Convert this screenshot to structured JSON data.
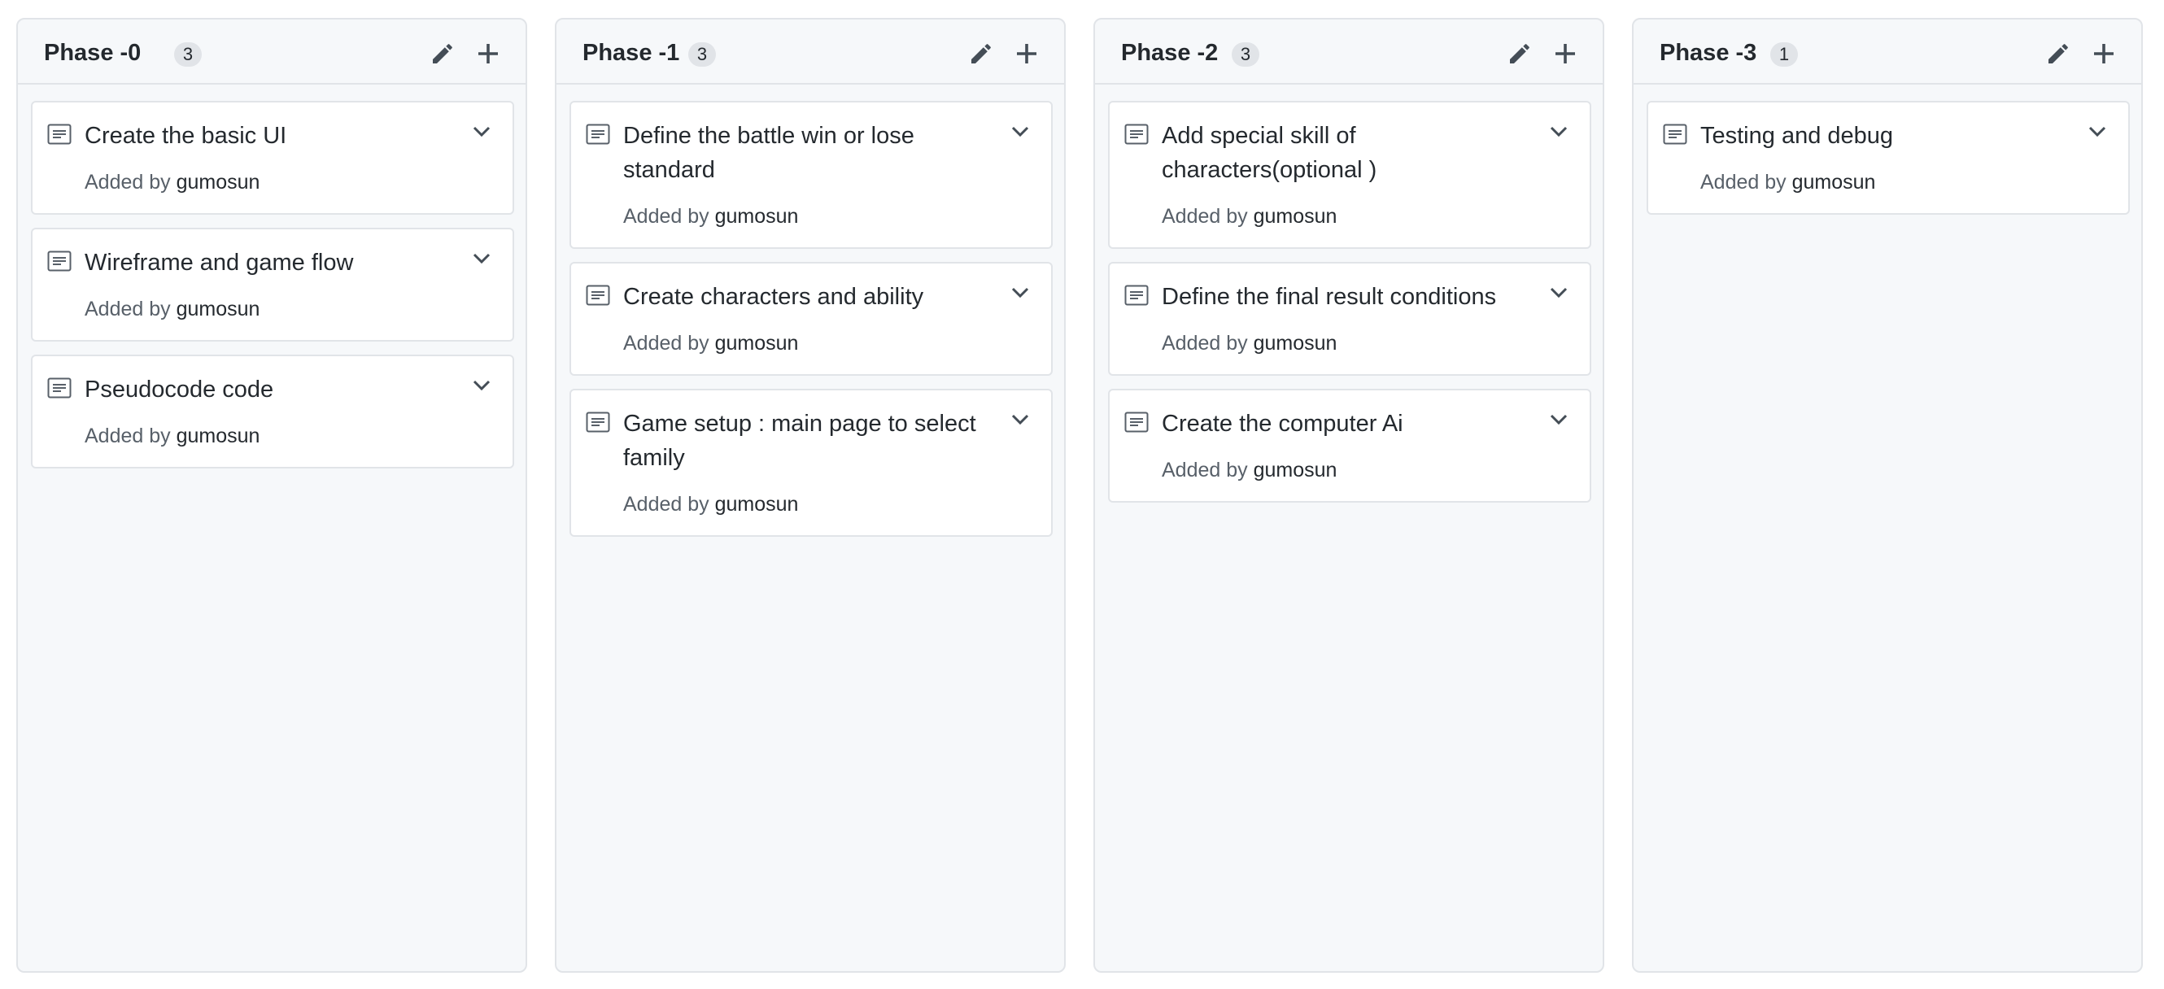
{
  "columns": [
    {
      "name": "Phase -0",
      "count": "3",
      "cards": [
        {
          "title": "Create the basic UI",
          "meta_prefix": "Added by",
          "author": "gumosun"
        },
        {
          "title": "Wireframe and game flow",
          "meta_prefix": "Added by",
          "author": "gumosun"
        },
        {
          "title": "Pseudocode code",
          "meta_prefix": "Added by",
          "author": "gumosun"
        }
      ]
    },
    {
      "name": "Phase -1",
      "count": "3",
      "cards": [
        {
          "title": "Define the battle win or lose standard",
          "meta_prefix": "Added by",
          "author": "gumosun"
        },
        {
          "title": "Create characters and ability",
          "meta_prefix": "Added by",
          "author": "gumosun"
        },
        {
          "title": "Game setup : main page to select family",
          "meta_prefix": "Added by",
          "author": "gumosun"
        }
      ]
    },
    {
      "name": "Phase -2",
      "count": "3",
      "cards": [
        {
          "title": "Add special skill of characters(optional )",
          "meta_prefix": "Added by",
          "author": "gumosun"
        },
        {
          "title": "Define the final result conditions",
          "meta_prefix": "Added by",
          "author": "gumosun"
        },
        {
          "title": "Create the computer Ai",
          "meta_prefix": "Added by",
          "author": "gumosun"
        }
      ]
    },
    {
      "name": "Phase -3",
      "count": "1",
      "cards": [
        {
          "title": "Testing and debug",
          "meta_prefix": "Added by",
          "author": "gumosun"
        }
      ]
    }
  ],
  "icons": {
    "edit": "pencil-icon",
    "add": "plus-icon",
    "card": "note-icon",
    "menu": "chevron-down-icon"
  },
  "colors": {
    "column_bg": "#f6f8fa",
    "border": "#e1e4e8",
    "text": "#24292e",
    "muted": "#586069",
    "icon": "#444d56"
  }
}
